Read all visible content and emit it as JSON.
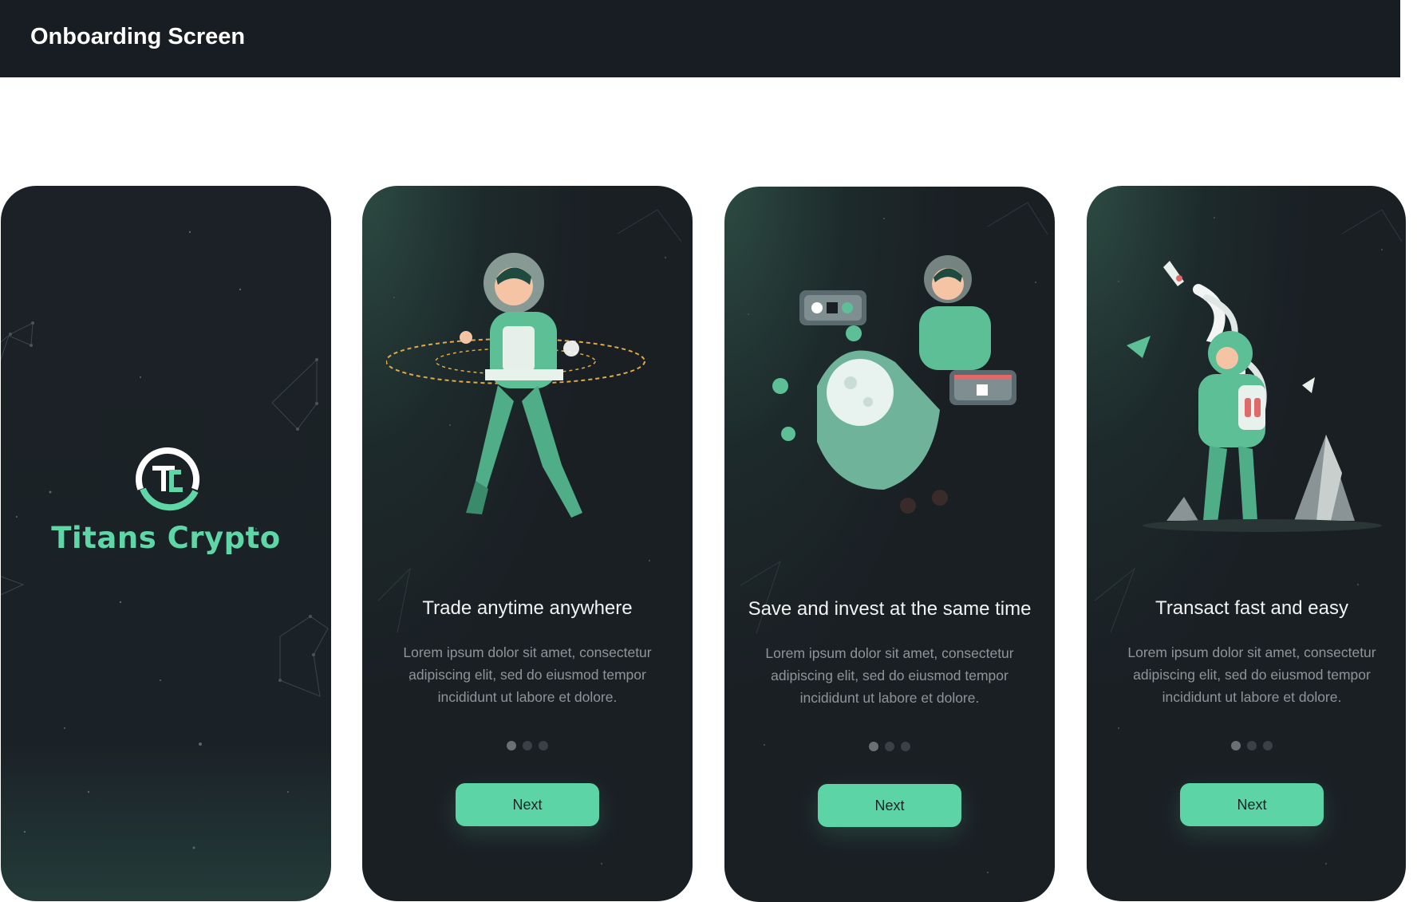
{
  "header": {
    "title": "Onboarding Screen"
  },
  "splash": {
    "brand_name": "Titans Crypto",
    "logo_text": "TC"
  },
  "slides": [
    {
      "title": "Trade anytime anywhere",
      "body": "Lorem ipsum dolor sit amet, consectetur adipiscing elit, sed do eiusmod tempor incididunt ut labore et dolore.",
      "button": "Next",
      "active_dot": 0,
      "dot_count": 3
    },
    {
      "title": "Save and invest at the same time",
      "body": "Lorem ipsum dolor sit amet, consectetur adipiscing elit, sed do eiusmod tempor incididunt ut labore et dolore.",
      "button": "Next",
      "active_dot": 0,
      "dot_count": 3
    },
    {
      "title": "Transact fast and easy",
      "body": "Lorem ipsum dolor sit amet, consectetur adipiscing elit, sed do eiusmod tempor incididunt ut labore et dolore.",
      "button": "Next",
      "active_dot": 0,
      "dot_count": 3
    }
  ],
  "colors": {
    "accent": "#5cd4a6",
    "screen_bg": "#1a1f24",
    "header_bg": "#181d24"
  }
}
